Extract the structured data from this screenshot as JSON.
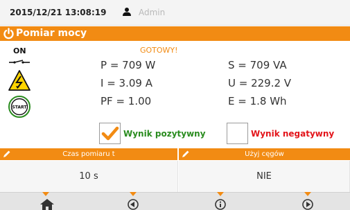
{
  "header": {
    "datetime": "2015/12/21 13:08:19",
    "user": "Admin"
  },
  "title_bar": {
    "title": "Pomiar mocy"
  },
  "indicators": {
    "on_label": "ON",
    "status": "GOTOWY!"
  },
  "readings": {
    "p": "P = 709 W",
    "i": "I = 3.09 A",
    "pf": "PF = 1.00",
    "s": "S = 709 VA",
    "u": "U = 229.2 V",
    "e": "E = 1.8 Wh"
  },
  "results": {
    "positive_label": "Wynik pozytywny",
    "positive_checked": true,
    "negative_label": "Wynik negatywny",
    "negative_checked": false
  },
  "params": {
    "measure_time_label": "Czas pomiaru t",
    "measure_time_value": "10 s",
    "use_clamps_label": "Użyj cęgów",
    "use_clamps_value": "NIE"
  },
  "nav": {
    "items": [
      "home-icon",
      "back-icon",
      "info-icon",
      "forward-icon"
    ]
  },
  "colors": {
    "accent": "#f28b13",
    "positive": "#2a8c1f",
    "negative": "#e3141a",
    "status": "#f28b13"
  }
}
